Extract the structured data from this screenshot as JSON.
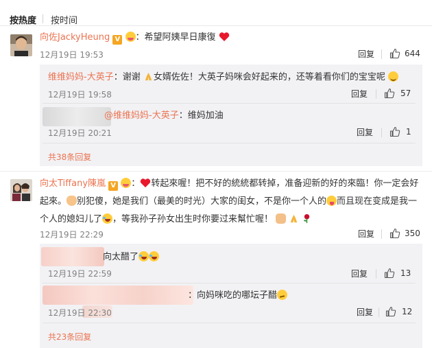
{
  "sort": {
    "hot": "按热度",
    "time": "按时间"
  },
  "actions": {
    "reply": "回复"
  },
  "comments": [
    {
      "author": "向佐JackyHeung",
      "verified": "V",
      "colon": "：",
      "text": "希望阿姨早日康復",
      "time": "12月19日 19:53",
      "likes": "644",
      "replies": [
        {
          "author": "维维妈妈-大英子",
          "colon": "：",
          "text_a": "谢谢",
          "text_b": "女婿佐佐！大英子妈咪会好起来的，还等着看你们的宝宝呢",
          "time": "12月19日 19:58",
          "likes": "57"
        },
        {
          "mention": "@维维妈妈-大英子",
          "text": "：维妈加油",
          "time": "12月19日 20:21",
          "likes": "1"
        }
      ],
      "more": "共38条回复"
    },
    {
      "author": "向太Tiffany陳嵐",
      "verified": "V",
      "colon": "：",
      "line1": "转起來喔！把不好的統統都转掉，准备迎新的好的來臨！你一定会好",
      "line2a": "起來。",
      "line2b": "别犯傻，她是我们（最美的时光）大家的闺女，不是你一个人的",
      "line2c": "而且现在变成是我一",
      "line3a": "个人的媳妇儿了",
      "line3b": "，等我孙子孙女出生时你要过来幫忙喔！",
      "time": "12月19日 22:29",
      "likes": "350",
      "replies": [
        {
          "text": "向太醋了",
          "time": "12月19日 22:59",
          "likes": "13"
        },
        {
          "text": "：向妈咪吃的哪坛子醋",
          "time": "12月19日 22:30",
          "likes": "12"
        }
      ],
      "more": "共23条回复"
    }
  ],
  "icons": {
    "thumb": "thumbs-up-icon",
    "heart": "heart-icon",
    "pray": "pray-icon",
    "verified": "verified-badge-icon"
  },
  "colors": {
    "accent": "#eb7350",
    "verified": "#f5a623",
    "reply_bg": "#f2f2f5"
  }
}
